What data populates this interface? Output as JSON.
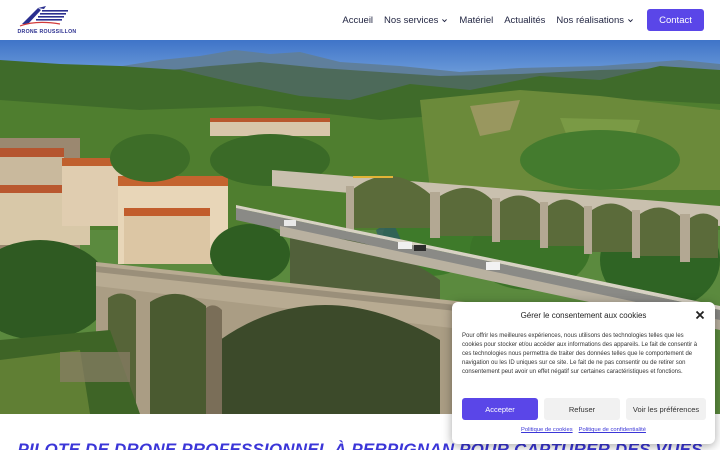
{
  "header": {
    "logo_text": "DRONE ROUSSILLON",
    "nav": [
      {
        "label": "Accueil",
        "dropdown": false
      },
      {
        "label": "Nos services",
        "dropdown": true
      },
      {
        "label": "Matériel",
        "dropdown": false
      },
      {
        "label": "Actualités",
        "dropdown": false
      },
      {
        "label": "Nos réalisations",
        "dropdown": true
      }
    ],
    "contact_label": "Contact"
  },
  "main": {
    "headline": "PILOTE DE DRONE PROFESSIONNEL À PERPIGNAN POUR CAPTURER DES VUES"
  },
  "cookie": {
    "title": "Gérer le consentement aux cookies",
    "body": "Pour offrir les meilleures expériences, nous utilisons des technologies telles que les cookies pour stocker et/ou accéder aux informations des appareils. Le fait de consentir à ces technologies nous permettra de traiter des données telles que le comportement de navigation ou les ID uniques sur ce site. Le fait de ne pas consentir ou de retirer son consentement peut avoir un effet négatif sur certaines caractéristiques et fonctions.",
    "accept_label": "Accepter",
    "refuse_label": "Refuser",
    "prefs_label": "Voir les préférences",
    "cookie_policy_link": "Politique de cookies",
    "privacy_policy_link": "Politique de confidentialité"
  },
  "colors": {
    "accent": "#5a46e8",
    "nav_text": "#1f2340",
    "headline": "#3b36d8",
    "logo": "#2b2f8f"
  },
  "icons": {
    "nav_dropdown": "chevron-down-icon",
    "close": "close-icon",
    "logo": "drone-logo-icon"
  }
}
